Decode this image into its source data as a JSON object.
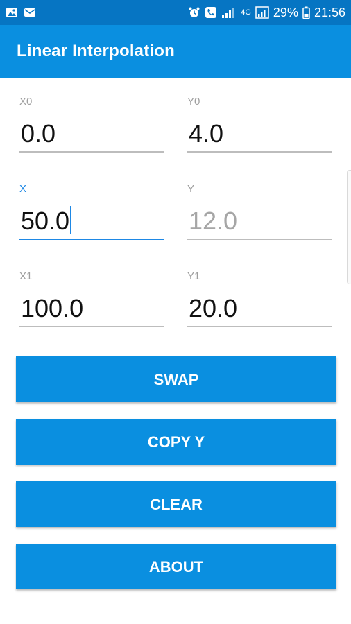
{
  "status_bar": {
    "battery_percent": "29%",
    "time": "21:56",
    "network": "4G",
    "icons": [
      "image-icon",
      "mail-icon",
      "alarm-icon",
      "phone-icon",
      "signal-icon",
      "battery-icon"
    ]
  },
  "app_bar": {
    "title": "Linear Interpolation"
  },
  "fields": {
    "x0": {
      "label": "X0",
      "value": "0.0"
    },
    "y0": {
      "label": "Y0",
      "value": "4.0"
    },
    "x": {
      "label": "X",
      "value": "50.0"
    },
    "y": {
      "label": "Y",
      "value": "12.0"
    },
    "x1": {
      "label": "X1",
      "value": "100.0"
    },
    "y1": {
      "label": "Y1",
      "value": "20.0"
    }
  },
  "buttons": {
    "swap": "SWAP",
    "copy_y": "COPY Y",
    "clear": "CLEAR",
    "about": "ABOUT"
  },
  "colors": {
    "status_bar": "#0675C3",
    "primary": "#0A8FE0",
    "focus": "#1E88E5",
    "label": "#9e9e9e",
    "underline": "#bdbdbd"
  }
}
